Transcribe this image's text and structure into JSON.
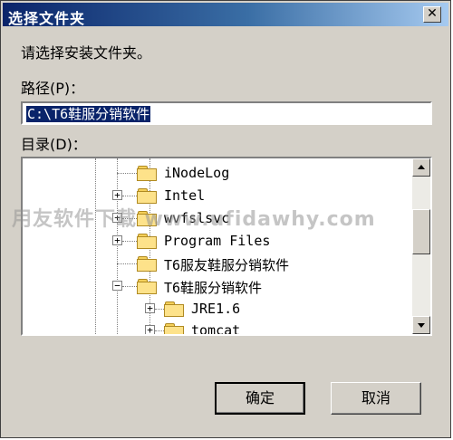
{
  "dialog": {
    "title": "选择文件夹",
    "close_glyph": "✕",
    "instruction": "请选择安装文件夹。",
    "path_label": "路径(P)：",
    "path_value": "C:\\T6鞋服分销软件",
    "dir_label": "目录(D)：",
    "ok_label": "确定",
    "cancel_label": "取消"
  },
  "tree": {
    "items": [
      {
        "label": "iNodeLog",
        "expander": ""
      },
      {
        "label": "Intel",
        "expander": "+"
      },
      {
        "label": "wvfslsvc",
        "expander": "+"
      },
      {
        "label": "Program Files",
        "expander": "+"
      },
      {
        "label": "T6服友鞋服分销软件",
        "expander": ""
      },
      {
        "label": "T6鞋服分销软件",
        "expander": "−"
      },
      {
        "label": "JRE1.6",
        "expander": "+"
      },
      {
        "label": "tomcat",
        "expander": "+"
      }
    ]
  },
  "watermark": "用友软件下载 www.ufidawhy.com",
  "colors": {
    "title_start": "#0a246a",
    "title_end": "#a6caf0",
    "face": "#d4d0c8",
    "selection": "#0a246a"
  }
}
